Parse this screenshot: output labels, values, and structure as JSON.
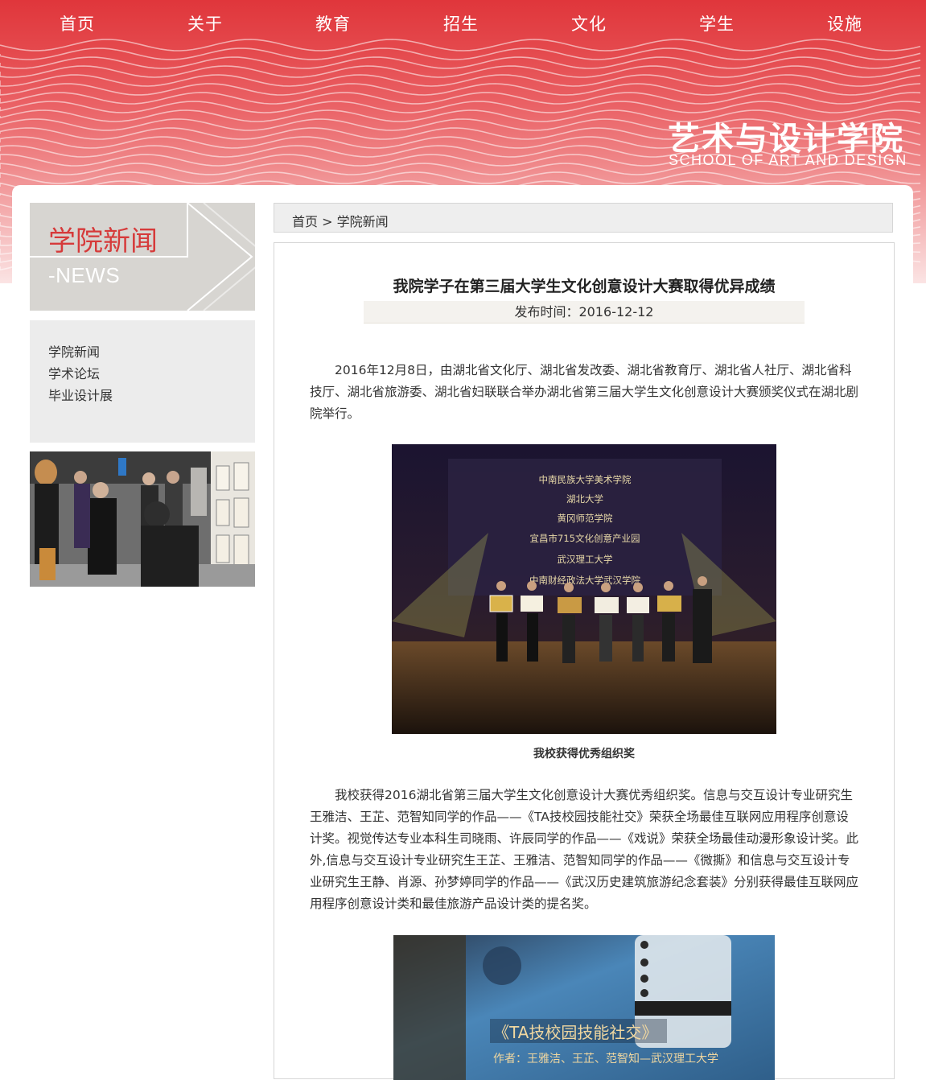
{
  "nav": {
    "items": [
      "首页",
      "关于",
      "教育",
      "招生",
      "文化",
      "学生",
      "设施"
    ]
  },
  "logo": {
    "cn": "艺术与设计学院",
    "en": "SCHOOL OF ART AND DESIGN"
  },
  "sidebar": {
    "banner_title": "学院新闻",
    "banner_sub": "-NEWS",
    "links": [
      "学院新闻",
      "学术论坛",
      "毕业设计展"
    ]
  },
  "breadcrumb": {
    "home": "首页",
    "sep": ">",
    "current": "学院新闻"
  },
  "article": {
    "title": "我院学子在第三届大学生文化创意设计大赛取得优异成绩",
    "date": "发布时间：2016-12-12",
    "para1": "2016年12月8日，由湖北省文化厅、湖北省发改委、湖北省教育厅、湖北省人社厅、湖北省科技厅、湖北省旅游委、湖北省妇联联合举办湖北省第三届大学生文化创意设计大赛颁奖仪式在湖北剧院举行。",
    "photo1_screen": [
      "中南民族大学美术学院",
      "湖北大学",
      "黄冈师范学院",
      "宜昌市715文化创意产业园",
      "武汉理工大学",
      "中南财经政法大学武汉学院"
    ],
    "caption1": "我校获得优秀组织奖",
    "para2": "我校获得2016湖北省第三届大学生文化创意设计大赛优秀组织奖。信息与交互设计专业研究生王雅洁、王芷、范智知同学的作品——《TA技校园技能社交》荣获全场最佳互联网应用程序创意设计奖。视觉传达专业本科生司晓雨、许辰同学的作品——《戏说》荣获全场最佳动漫形象设计奖。此外,信息与交互设计专业研究生王芷、王雅洁、范智知同学的作品——《微撕》和信息与交互设计专业研究生王静、肖源、孙梦婷同学的作品——《武汉历史建筑旅游纪念套装》分别获得最佳互联网应用程序创意设计类和最佳旅游产品设计类的提名奖。",
    "photo2_title": "《TA技校园技能社交》",
    "photo2_sub": "作者：王雅洁、王芷、范智知—武汉理工大学"
  },
  "colors": {
    "brand_red": "#e0363b",
    "title_red": "#d63a3a"
  }
}
